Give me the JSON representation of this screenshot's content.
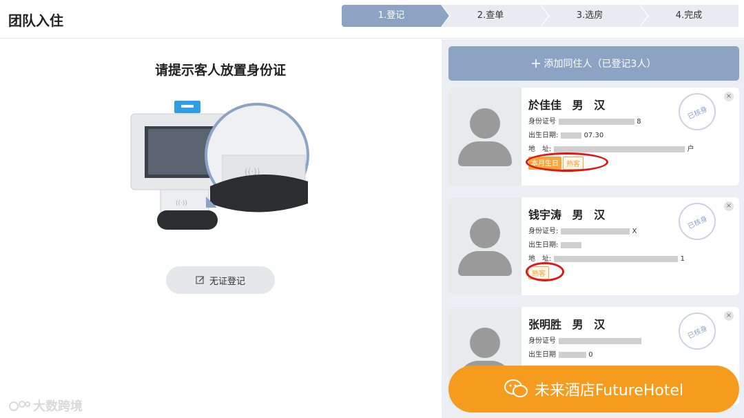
{
  "app": {
    "title": "团队入住"
  },
  "steps": [
    "1.登记",
    "2.查单",
    "3.选房",
    "4.完成"
  ],
  "left": {
    "prompt": "请提示客人放置身份证",
    "nocert_label": "无证登记",
    "watermark": "大数跨境"
  },
  "right": {
    "add_label": "添加同住人（已登记3人）",
    "stamp_text": "已核身",
    "guests": [
      {
        "name": "於佳佳",
        "gender": "男",
        "ethnicity": "汉",
        "id_label": "身份证号",
        "id_tail": "8",
        "dob_label": "出生日期:",
        "dob_tail": "07.30",
        "addr_label": "地　址:",
        "addr_tail": "户",
        "tags": [
          "本月生日",
          "熟客"
        ]
      },
      {
        "name": "钱宇涛",
        "gender": "男",
        "ethnicity": "汉",
        "id_label": "身份证号:",
        "id_tail": "X",
        "dob_label": "出生日期:",
        "dob_tail": "",
        "addr_label": "地　址:",
        "addr_tail": "1",
        "tags": [
          "熟客"
        ]
      },
      {
        "name": "张明胜",
        "gender": "男",
        "ethnicity": "汉",
        "id_label": "身份证号",
        "id_tail": "",
        "dob_label": "出生日期",
        "dob_tail": "0",
        "addr_label": "",
        "addr_tail": "",
        "tags": []
      }
    ]
  },
  "banner": {
    "text": "未来酒店FutureHotel"
  },
  "colors": {
    "accent": "#8da3c4",
    "orange": "#f59b1e",
    "highlight_ring": "#e0151b"
  }
}
